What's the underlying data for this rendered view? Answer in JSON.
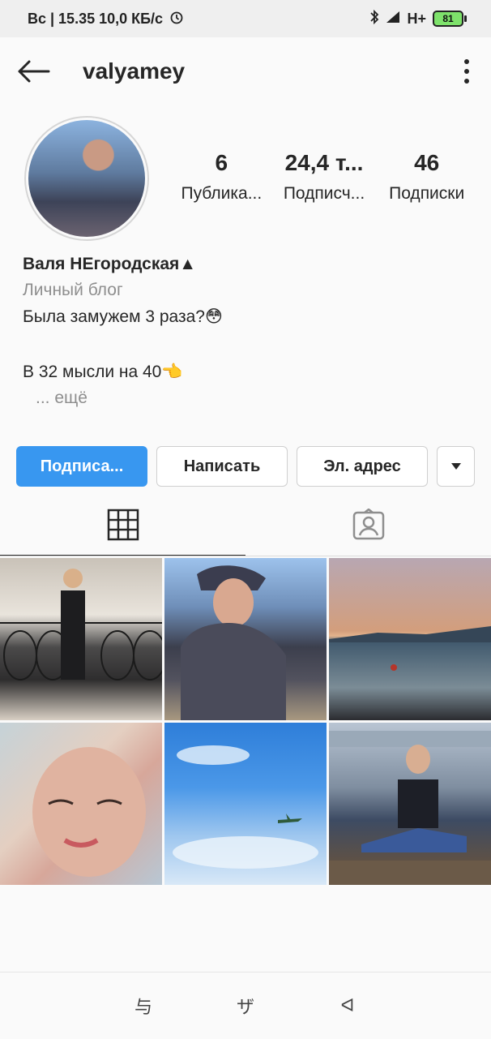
{
  "status_bar": {
    "left_text": "Вс | 15.35  10,0 КБ/с",
    "network": "H+",
    "battery": "81"
  },
  "header": {
    "username": "valyamey"
  },
  "stats": [
    {
      "value": "6",
      "label": "Публика..."
    },
    {
      "value": "24,4 т...",
      "label": "Подписч..."
    },
    {
      "value": "46",
      "label": "Подписки"
    }
  ],
  "bio": {
    "name": "Валя НЕгородская▲",
    "category": "Личный блог",
    "line1": "Была замужем 3 раза?😳",
    "line2": "В 32 мысли на 40👈",
    "more": "... ещё"
  },
  "buttons": {
    "follow": "Подписа...",
    "message": "Написать",
    "email": "Эл. адрес"
  },
  "posts": [
    {
      "name": "post-1"
    },
    {
      "name": "post-2"
    },
    {
      "name": "post-3"
    },
    {
      "name": "post-4"
    },
    {
      "name": "post-5"
    },
    {
      "name": "post-6"
    }
  ],
  "nav_bar": {
    "back": "ᐊ",
    "home": "ザ",
    "recent": "与"
  },
  "colors": {
    "accent": "#3897f0",
    "text": "#262626",
    "secondary_text": "#8e8e8e"
  }
}
